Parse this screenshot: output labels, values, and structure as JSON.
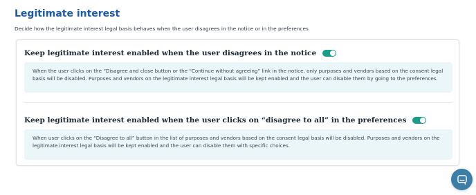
{
  "header": {
    "title": "Legitimate interest",
    "description": "Decide how the legitimate interest legal basis behaves when the user disagrees in the notice or in the preferences"
  },
  "settings": [
    {
      "title": "Keep legitimate interest enabled when the user disagrees in the notice",
      "enabled": true,
      "info": "When the user clicks on the “Disagree and close button or the “Continue without agreeing” link in the notice, only purposes and vendors based on the consent legal basis will be disabled. Purposes and vendors on the legitimate interest legal basis will be kept enabled and the user can disable them by going to the preferences."
    },
    {
      "title": "Keep legitimate interest enabled when the user clicks on “disagree to all” in the preferences",
      "enabled": true,
      "info": "When user clicks on the “Disagree to all” button in the list of purposes and vendors based on the consent legal basis will be disabled. Purposes and vendors on the legitimate interest legal basis will be kept enabled and the user can disable them with specific choices."
    }
  ],
  "chat": {
    "icon": "chat-icon"
  },
  "colors": {
    "accent": "#1a9e8a",
    "title": "#1d5aa8",
    "info_bg": "#eaf6f7",
    "chat_bg": "#3b7fa8"
  }
}
